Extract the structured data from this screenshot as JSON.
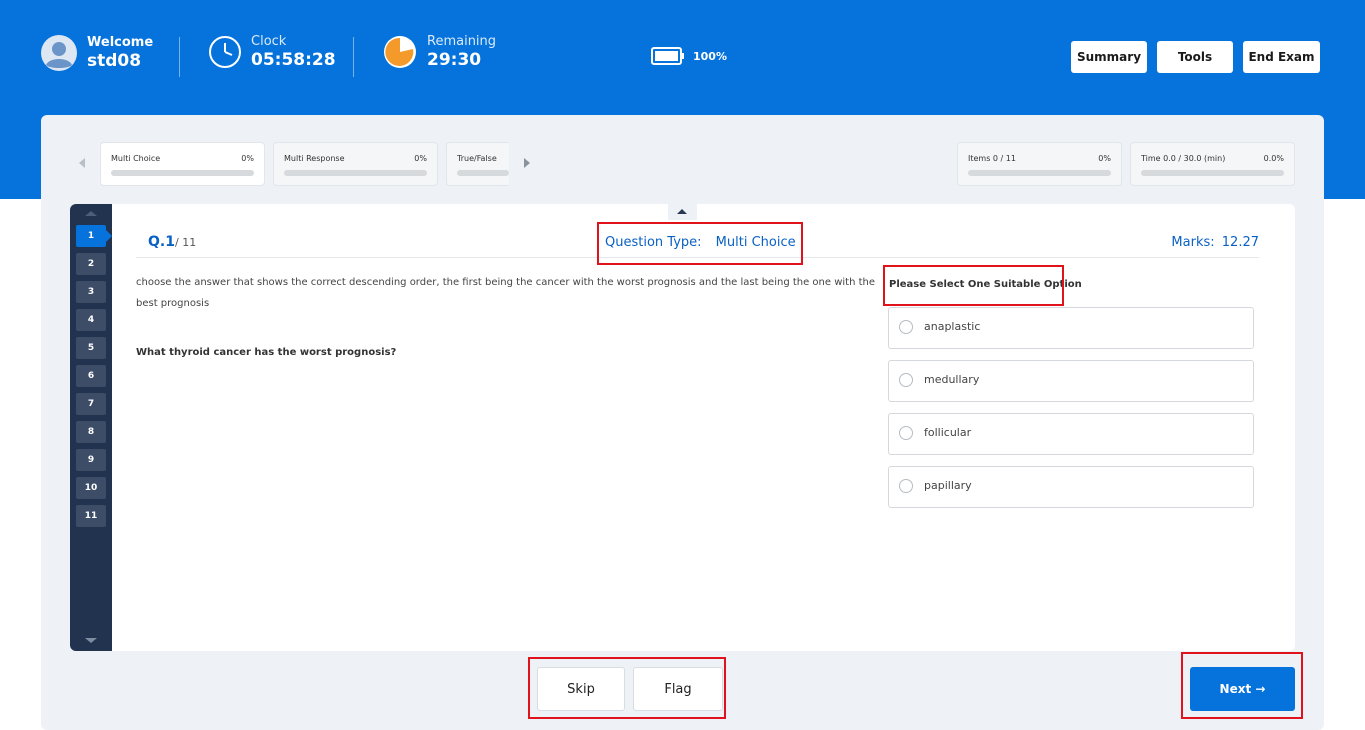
{
  "header": {
    "welcome_label": "Welcome",
    "username": "std08",
    "clock_label": "Clock",
    "clock_value": "05:58:28",
    "remaining_label": "Remaining",
    "remaining_value": "29:30",
    "battery_percent": "100%",
    "buttons": {
      "summary": "Summary",
      "tools": "Tools",
      "end_exam": "End Exam"
    }
  },
  "progress": {
    "sections": [
      {
        "label": "Multi Choice",
        "value": "0%",
        "fill": 0
      },
      {
        "label": "Multi Response",
        "value": "0%",
        "fill": 0
      },
      {
        "label": "True/False",
        "value": "",
        "fill": 0
      }
    ],
    "items": {
      "label": "Items 0 / 11",
      "value": "0%",
      "fill": 0
    },
    "time": {
      "label": "Time 0.0 / 30.0 (min)",
      "value": "0.0%",
      "fill": 0
    }
  },
  "question_nav": {
    "numbers": [
      "1",
      "2",
      "3",
      "4",
      "5",
      "6",
      "7",
      "8",
      "9",
      "10",
      "11"
    ],
    "active": "1"
  },
  "question": {
    "number": "Q.1",
    "total": "/ 11",
    "type_label": "Question Type:",
    "type_value": "Multi Choice",
    "marks_label": "Marks:",
    "marks_value": "12.27",
    "instructions": "choose the answer that shows the correct descending order, the first being the cancer with the worst prognosis and the last being the one with the best prognosis",
    "prompt": "What thyroid cancer has the worst prognosis?",
    "select_hint": "Please Select One Suitable Option",
    "options": [
      "anaplastic",
      "medullary",
      "follicular",
      "papillary"
    ]
  },
  "footer": {
    "skip": "Skip",
    "flag": "Flag",
    "next": "Next →"
  },
  "colors": {
    "brand": "#0673dc",
    "sidebar": "#223350",
    "highlight": "#e0121b"
  }
}
